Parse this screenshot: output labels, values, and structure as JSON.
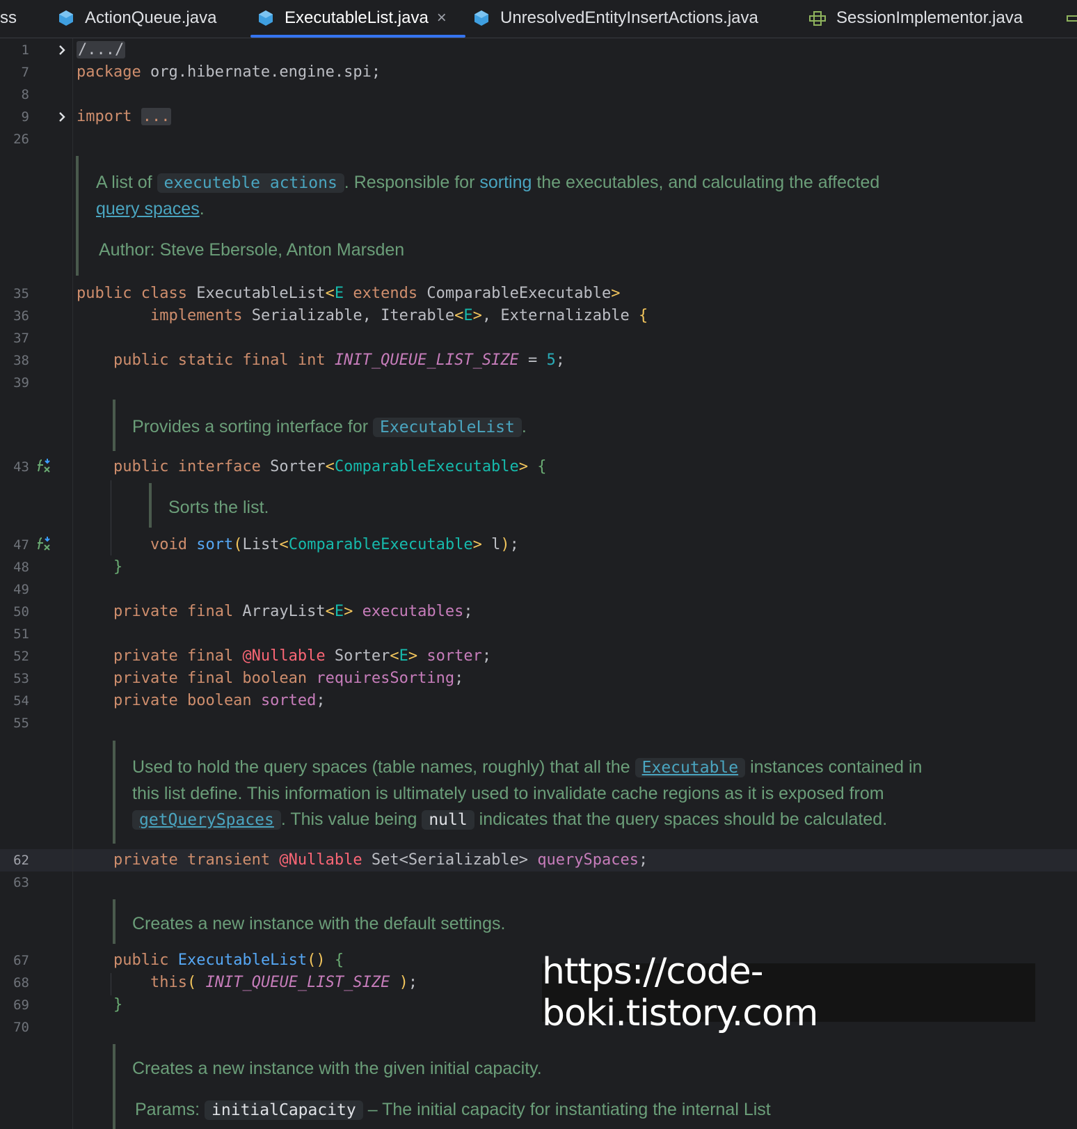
{
  "tabs": [
    {
      "label": "ss",
      "icon": "none"
    },
    {
      "label": "ActionQueue.java",
      "icon": "java-class-icon"
    },
    {
      "label": "ExecutableList.java",
      "icon": "java-class-icon",
      "active": true,
      "close": "×"
    },
    {
      "label": "UnresolvedEntityInsertActions.java",
      "icon": "java-class-icon"
    },
    {
      "label": "SessionImplementor.java",
      "icon": "java-interface-icon"
    }
  ],
  "line_numbers": [
    "1",
    "7",
    "8",
    "9",
    "26",
    "35",
    "36",
    "37",
    "38",
    "39",
    "43",
    "47",
    "48",
    "49",
    "50",
    "51",
    "52",
    "53",
    "54",
    "55",
    "62",
    "63",
    "67",
    "68",
    "69",
    "70"
  ],
  "code": {
    "l1_fold": "/.../",
    "l7_pkg_kw": "package",
    "l7_pkg_name": " org.hibernate.engine.spi;",
    "l9_import_kw": "import",
    "l9_import_fold": "...",
    "l35": {
      "public": "public",
      "class": "class",
      "name": "ExecutableList",
      "lt": "<",
      "E": "E",
      "extends": "extends",
      "bound": "ComparableExecutable",
      "gt": ">"
    },
    "l36": {
      "implements": "implements",
      "ifaces": "Serializable, Iterable",
      "lt": "<",
      "E": "E",
      "gt": ">",
      "last": ", Externalizable ",
      "brace": "{"
    },
    "l38": {
      "mods": "public static final int",
      "name": "INIT_QUEUE_LIST_SIZE",
      "eq": " = ",
      "val": "5",
      "semi": ";"
    },
    "l43": {
      "mods": "public interface",
      "name": " Sorter",
      "lt": "<",
      "tp": "ComparableExecutable",
      "gt": ">",
      "brace": "{"
    },
    "l47": {
      "kw": "void",
      "fn": "sort",
      "p1": "(",
      "type": "List",
      "lt": "<",
      "tp": "ComparableExecutable",
      "gt": ">",
      "rest": " l",
      "p2": ")",
      "semi": ";"
    },
    "l48": "}",
    "l50": {
      "mods": "private final",
      "type": " ArrayList",
      "lt": "<",
      "E": "E",
      "gt": ">",
      "name": "executables",
      "semi": ";"
    },
    "l52": {
      "mods": "private final",
      "ann": "@Nullable",
      "type": " Sorter",
      "lt": "<",
      "E": "E",
      "gt": ">",
      "name": "sorter",
      "semi": ";"
    },
    "l53": {
      "mods": "private final boolean",
      "name": "requiresSorting",
      "semi": ";"
    },
    "l54": {
      "mods": "private boolean",
      "name": "sorted",
      "semi": ";"
    },
    "l62": {
      "mods": "private transient",
      "ann": "@Nullable",
      "type": " Set<Serializable> ",
      "name": "querySpaces",
      "semi": ";"
    },
    "l67": {
      "mods": "public",
      "fn": "ExecutableList",
      "parens": "()",
      "brace": "{"
    },
    "l68": {
      "kw": "this",
      "p1": "(",
      "name": "INIT_QUEUE_LIST_SIZE",
      "p2": ")",
      "semi": ";"
    },
    "l69": "}"
  },
  "docs": {
    "class_doc_a": "A list of ",
    "class_doc_chip": "executeble actions",
    "class_doc_b": ". Responsible for ",
    "class_doc_sorting": "sorting",
    "class_doc_c": " the executables, and calculating the affected",
    "class_doc_link": "query spaces",
    "class_doc_d": ".",
    "author_label": "Author:",
    "author_value": "Steve Ebersole, Anton Marsden",
    "sorter_doc_a": "Provides a sorting interface for ",
    "sorter_doc_chip": "ExecutableList",
    "sorter_doc_b": ".",
    "sort_doc": "Sorts the list.",
    "qs_doc_a": "Used to hold the query spaces (table names, roughly) that all the ",
    "qs_doc_chip": "Executable",
    "qs_doc_b": " instances contained in",
    "qs_doc_line2": "this list define. This information is ultimately used to invalidate cache regions as it is exposed from",
    "qs_doc_chip2": "getQuerySpaces",
    "qs_doc_c": ". This value being ",
    "qs_doc_null": "null",
    "qs_doc_d": " indicates that the query spaces should be calculated.",
    "ctor_doc": "Creates a new instance with the default settings.",
    "ctor2_doc": "Creates a new instance with the given initial capacity.",
    "params_label": "Params:",
    "params_chip": "initialCapacity",
    "params_desc": " – The initial capacity for instantiating the internal List"
  },
  "watermark": "https://code-boki.tistory.com",
  "colors": {
    "background": "#1e1f22",
    "keyword": "#cf8e6d",
    "type_param": "#16baac",
    "field": "#c77dbb",
    "annotation": "#fa6675",
    "doc_text": "#6b9e79",
    "tab_underline": "#3574f0"
  }
}
